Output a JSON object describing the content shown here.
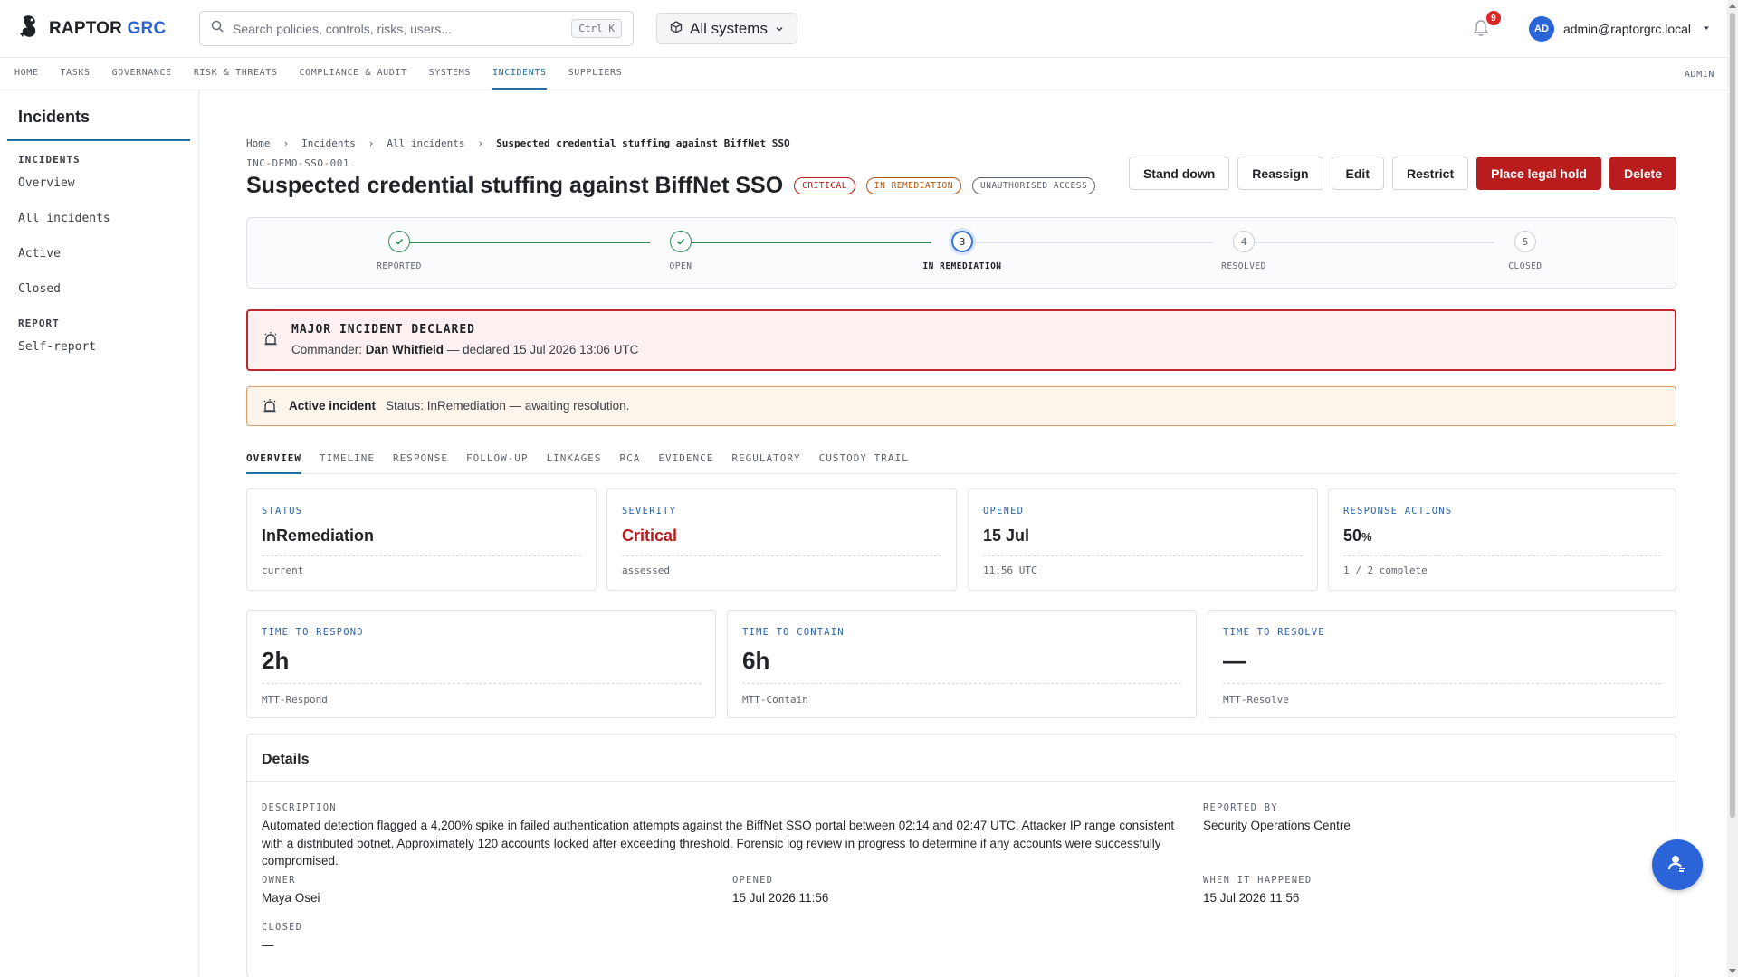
{
  "brand": {
    "name": "RAPTOR",
    "suffix": "GRC"
  },
  "search": {
    "placeholder": "Search policies, controls, risks, users...",
    "shortcut": "Ctrl K"
  },
  "systems_selector": {
    "label": "All systems"
  },
  "notifications": {
    "count": "9"
  },
  "user": {
    "initials": "AD",
    "email": "admin@raptorgrc.local"
  },
  "nav": {
    "items": [
      "HOME",
      "TASKS",
      "GOVERNANCE",
      "RISK & THREATS",
      "COMPLIANCE & AUDIT",
      "SYSTEMS",
      "INCIDENTS",
      "SUPPLIERS"
    ],
    "active": "INCIDENTS",
    "admin": "ADMIN"
  },
  "sidebar": {
    "title": "Incidents",
    "section_incidents": "INCIDENTS",
    "items": [
      "Overview",
      "All incidents",
      "Active",
      "Closed"
    ],
    "section_report": "REPORT",
    "report_items": [
      "Self-report"
    ]
  },
  "breadcrumb": [
    "Home",
    "Incidents",
    "All incidents",
    "Suspected credential stuffing against BiffNet SSO"
  ],
  "incident": {
    "id": "INC-DEMO-SSO-001",
    "title": "Suspected credential stuffing against BiffNet SSO",
    "tags": {
      "severity": "CRITICAL",
      "status": "IN REMEDIATION",
      "category": "UNAUTHORISED ACCESS"
    }
  },
  "actions": {
    "stand_down": "Stand down",
    "reassign": "Reassign",
    "edit": "Edit",
    "restrict": "Restrict",
    "legal_hold": "Place legal hold",
    "delete": "Delete"
  },
  "stepper": {
    "steps": [
      {
        "num": "1",
        "label": "REPORTED",
        "state": "done"
      },
      {
        "num": "2",
        "label": "OPEN",
        "state": "done"
      },
      {
        "num": "3",
        "label": "IN REMEDIATION",
        "state": "current"
      },
      {
        "num": "4",
        "label": "RESOLVED",
        "state": "todo"
      },
      {
        "num": "5",
        "label": "CLOSED",
        "state": "todo"
      }
    ]
  },
  "major_alert": {
    "title": "MAJOR INCIDENT DECLARED",
    "commander_label": "Commander:",
    "commander": "Dan Whitfield",
    "declared": "— declared 15 Jul 2026 13:06 UTC"
  },
  "active_alert": {
    "label": "Active incident",
    "text": "Status: InRemediation — awaiting resolution."
  },
  "tabs": [
    "OVERVIEW",
    "TIMELINE",
    "RESPONSE",
    "FOLLOW-UP",
    "LINKAGES",
    "RCA",
    "EVIDENCE",
    "REGULATORY",
    "CUSTODY TRAIL"
  ],
  "cards": {
    "status": {
      "label": "STATUS",
      "value": "InRemediation",
      "sub": "current"
    },
    "severity": {
      "label": "SEVERITY",
      "value": "Critical",
      "sub": "assessed"
    },
    "opened": {
      "label": "OPENED",
      "value": "15 Jul",
      "sub": "11:56 UTC"
    },
    "response": {
      "label": "RESPONSE ACTIONS",
      "value": "50",
      "unit": "%",
      "sub": "1 / 2 complete"
    }
  },
  "metrics": {
    "respond": {
      "label": "TIME TO RESPOND",
      "value": "2h",
      "sub": "MTT-Respond"
    },
    "contain": {
      "label": "TIME TO CONTAIN",
      "value": "6h",
      "sub": "MTT-Contain"
    },
    "resolve": {
      "label": "TIME TO RESOLVE",
      "value": "—",
      "sub": "MTT-Resolve"
    }
  },
  "details": {
    "title": "Details",
    "description_label": "DESCRIPTION",
    "description": "Automated detection flagged a 4,200% spike in failed authentication attempts against the BiffNet SSO portal between 02:14 and 02:47 UTC. Attacker IP range consistent with a distributed botnet. Approximately 120 accounts locked after exceeding threshold. Forensic log review in progress to determine if any accounts were successfully compromised.",
    "reported_by_label": "REPORTED BY",
    "reported_by": "Security Operations Centre",
    "owner_label": "OWNER",
    "owner": "Maya Osei",
    "opened_label": "OPENED",
    "opened": "15 Jul 2026 11:56",
    "when_label": "WHEN IT HAPPENED",
    "when": "15 Jul 2026 11:56",
    "closed_label": "CLOSED",
    "closed": "—"
  },
  "colors": {
    "accent": "#2b63d9",
    "danger": "#b91c1c",
    "success": "#2e8b57",
    "warning_border": "#d59c6a"
  }
}
